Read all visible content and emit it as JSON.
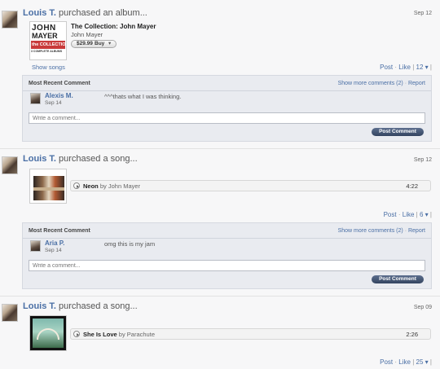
{
  "feed": [
    {
      "user": "Louis T.",
      "action": "purchased an album...",
      "date": "Sep 12",
      "album": {
        "title": "The Collection: John Mayer",
        "artist": "John Mayer",
        "price": "$29.99",
        "buy_label": "Buy",
        "cover_text_1": "JOHN",
        "cover_text_2": "MAYER",
        "cover_text_3": "the COLLECTION",
        "cover_text_4": "3 COMPLETE ALBUMS",
        "show_songs": "Show songs"
      },
      "post_label": "Post",
      "like_label": "Like",
      "like_count": "12",
      "comment_box": {
        "title": "Most Recent Comment",
        "show_more": "Show more comments (2)",
        "report": "Report",
        "commenter": "Alexis M.",
        "comment_date": "Sep 14",
        "comment_text": "^^^thats what I was thinking.",
        "input_placeholder": "Write a comment...",
        "post_button": "Post Comment"
      }
    },
    {
      "user": "Louis T.",
      "action": "purchased a song...",
      "date": "Sep 12",
      "song": {
        "title": "Neon",
        "by": "by",
        "artist": "John Mayer",
        "duration": "4:22"
      },
      "post_label": "Post",
      "like_label": "Like",
      "like_count": "6",
      "comment_box": {
        "title": "Most Recent Comment",
        "show_more": "Show more comments (2)",
        "report": "Report",
        "commenter": "Aria P.",
        "comment_date": "Sep 14",
        "comment_text": "omg this is my jam",
        "input_placeholder": "Write a comment...",
        "post_button": "Post Comment"
      }
    },
    {
      "user": "Louis T.",
      "action": "purchased a song...",
      "date": "Sep 09",
      "song": {
        "title": "She Is Love",
        "by": "by",
        "artist": "Parachute",
        "duration": "2:26"
      },
      "post_label": "Post",
      "like_label": "Like",
      "like_count": "25"
    }
  ],
  "separator": "·",
  "dropdown_glyph": "▾",
  "colors": {
    "link": "#4a6fa5",
    "comment_bg": "#e9ebf0",
    "button": "#334460"
  }
}
